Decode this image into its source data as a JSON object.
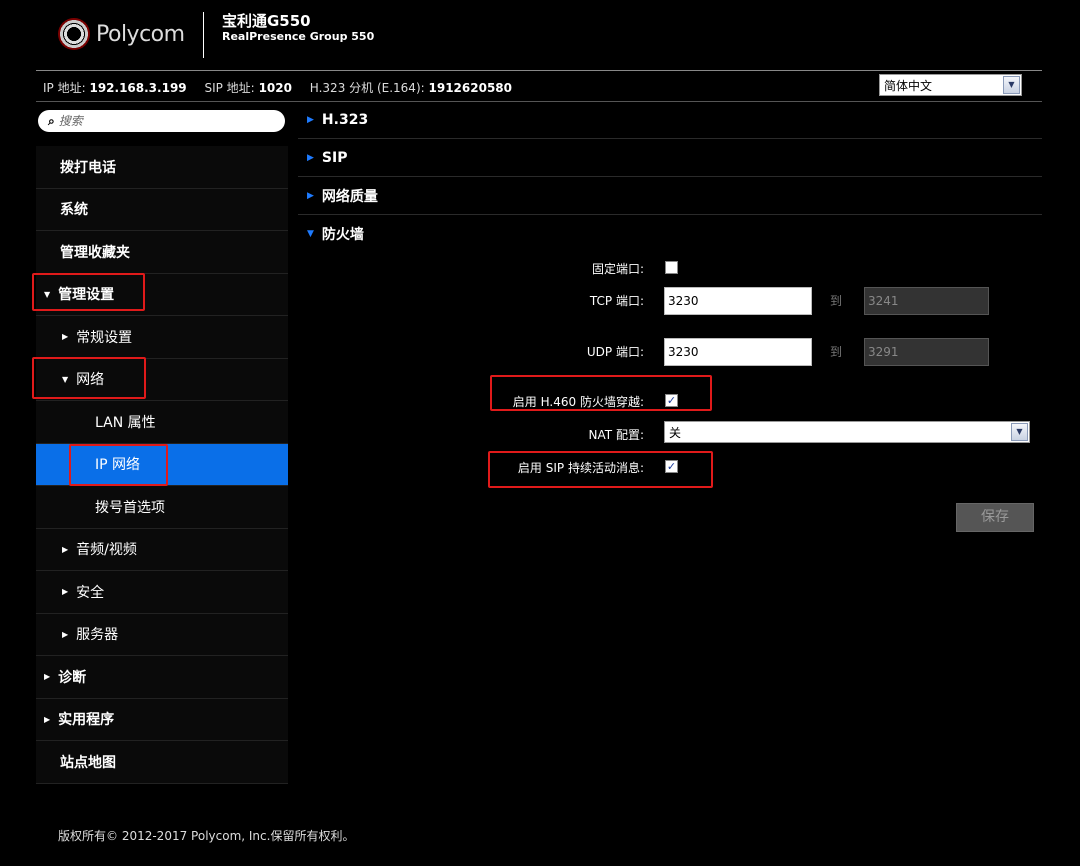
{
  "header": {
    "logo_text": "Polycom",
    "product_title": "宝利通G550",
    "product_subtitle": "RealPresence Group 550"
  },
  "infobar": {
    "ip_label": "IP 地址:",
    "ip_value": "192.168.3.199",
    "sip_label": "SIP 地址:",
    "sip_value": "1020",
    "h323_label": "H.323 分机 (E.164):",
    "h323_value": "1912620580"
  },
  "language": {
    "selected": "简体中文"
  },
  "search": {
    "placeholder": "搜索"
  },
  "sidebar": {
    "items": [
      {
        "label": "拨打电话"
      },
      {
        "label": "系统"
      },
      {
        "label": "管理收藏夹"
      },
      {
        "label": "管理设置"
      },
      {
        "label": "常规设置"
      },
      {
        "label": "网络"
      },
      {
        "label": "LAN 属性"
      },
      {
        "label": "IP 网络"
      },
      {
        "label": "拨号首选项"
      },
      {
        "label": "音频/视频"
      },
      {
        "label": "安全"
      },
      {
        "label": "服务器"
      },
      {
        "label": "诊断"
      },
      {
        "label": "实用程序"
      },
      {
        "label": "站点地图"
      }
    ]
  },
  "sections": [
    {
      "label": "H.323"
    },
    {
      "label": "SIP"
    },
    {
      "label": "网络质量"
    },
    {
      "label": "防火墙"
    }
  ],
  "firewall": {
    "fixed_ports_label": "固定端口:",
    "fixed_ports_checked": false,
    "tcp_label": "TCP 端口:",
    "tcp_from": "3230",
    "tcp_to": "3241",
    "udp_label": "UDP 端口:",
    "udp_from": "3230",
    "udp_to": "3291",
    "to_label": "到",
    "h460_label": "启用 H.460 防火墙穿越:",
    "h460_checked": true,
    "nat_label": "NAT 配置:",
    "nat_value": "关",
    "sip_keepalive_label": "启用 SIP 持续活动消息:",
    "sip_keepalive_checked": true
  },
  "save_label": "保存",
  "footer": {
    "copyright": "版权所有© 2012-2017 Polycom, Inc.保留所有权利。"
  },
  "colors": {
    "accent": "#0a6fe8",
    "highlight_box": "#e01a1a",
    "arrow_blue": "#1e7bff"
  }
}
